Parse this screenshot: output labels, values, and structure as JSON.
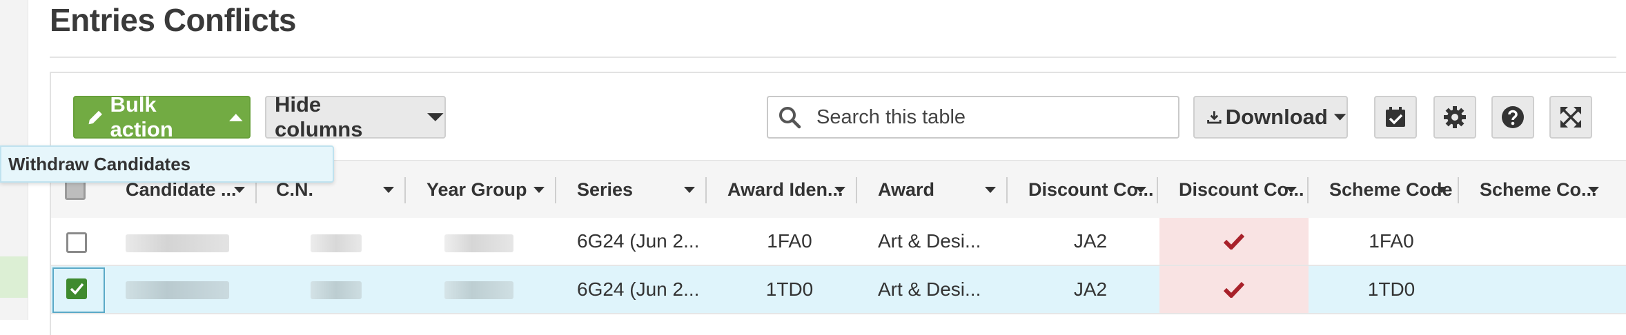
{
  "page": {
    "title": "Entries Conflicts"
  },
  "toolbar": {
    "bulk_action_label": "Bulk action",
    "hide_columns_label": "Hide columns",
    "search_placeholder": "Search this table",
    "download_label": "Download",
    "icons": [
      "pencil-icon",
      "caret-up-icon",
      "caret-down-icon",
      "search-icon",
      "download-icon",
      "calendar-check-icon",
      "gear-icon",
      "help-icon",
      "expand-icon"
    ]
  },
  "bulk_menu": {
    "items": [
      {
        "label": "Withdraw Candidates"
      }
    ]
  },
  "table": {
    "columns": [
      {
        "label": "Candidate ..."
      },
      {
        "label": "C.N."
      },
      {
        "label": "Year Group"
      },
      {
        "label": "Series"
      },
      {
        "label": "Award Iden..."
      },
      {
        "label": "Award"
      },
      {
        "label": "Discount Co..."
      },
      {
        "label": "Discount Co..."
      },
      {
        "label": "Scheme Code"
      },
      {
        "label": "Scheme Co..."
      }
    ],
    "rows": [
      {
        "selected": false,
        "series": "6G24 (Jun 2...",
        "award_identifier": "1FA0",
        "award": "Art & Desi...",
        "discount_code": "JA2",
        "discount_conflict": "✔",
        "scheme_code": "1FA0"
      },
      {
        "selected": true,
        "series": "6G24 (Jun 2...",
        "award_identifier": "1TD0",
        "award": "Art & Desi...",
        "discount_code": "JA2",
        "discount_conflict": "✔",
        "scheme_code": "1TD0"
      }
    ]
  },
  "colors": {
    "bulk_action_bg": "#72ab43",
    "selected_row_bg": "#dff4fb",
    "conflict_cell_bg": "#f9e3e3",
    "conflict_check": "#a8212a",
    "checkbox_checked": "#3f8a2e"
  }
}
